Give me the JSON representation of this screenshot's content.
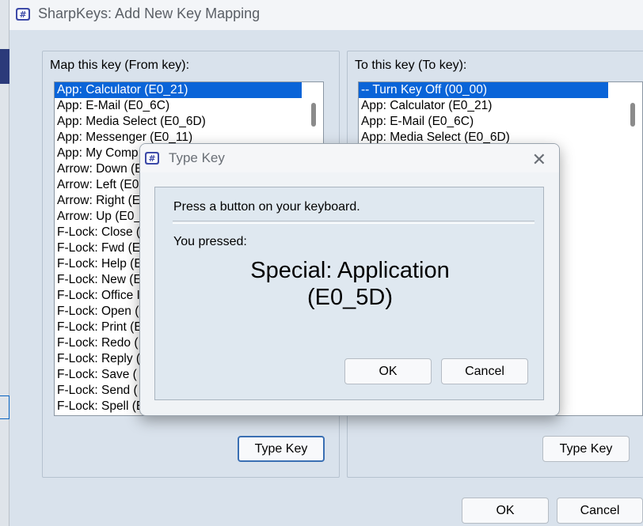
{
  "window": {
    "title": "SharpKeys: Add New Key Mapping"
  },
  "from_key": {
    "label": "Map this key (From key):",
    "items": [
      "App: Calculator (E0_21)",
      "App: E-Mail (E0_6C)",
      "App: Media Select (E0_6D)",
      "App: Messenger (E0_11)",
      "App: My Comp",
      "Arrow: Down (E",
      "Arrow: Left (E0",
      "Arrow: Right (E",
      "Arrow: Up (E0_",
      "F-Lock: Close (",
      "F-Lock: Fwd (E",
      "F-Lock: Help (E",
      "F-Lock: New (E",
      "F-Lock: Office I",
      "F-Lock: Open (",
      "F-Lock: Print (E",
      "F-Lock: Redo (",
      "F-Lock: Reply (",
      "F-Lock: Save (",
      "F-Lock: Send (",
      "F-Lock: Spell (E"
    ],
    "selected_index": 0,
    "type_key_button": "Type Key"
  },
  "to_key": {
    "label": "To this key (To key):",
    "items": [
      "-- Turn Key Off (00_00)",
      "App: Calculator (E0_21)",
      "App: E-Mail (E0_6C)",
      "App: Media Select (E0_6D)"
    ],
    "selected_index": 0,
    "type_key_button": "Type Key"
  },
  "footer": {
    "ok": "OK",
    "cancel": "Cancel"
  },
  "dialog": {
    "title": "Type Key",
    "close_glyph": "✕",
    "prompt": "Press a button on your keyboard.",
    "pressed_label": "You pressed:",
    "key_line1": "Special: Application",
    "key_line2": "(E0_5D)",
    "ok": "OK",
    "cancel": "Cancel"
  },
  "colors": {
    "selection": "#0a64d8",
    "focus_border": "#3a6fb3"
  }
}
